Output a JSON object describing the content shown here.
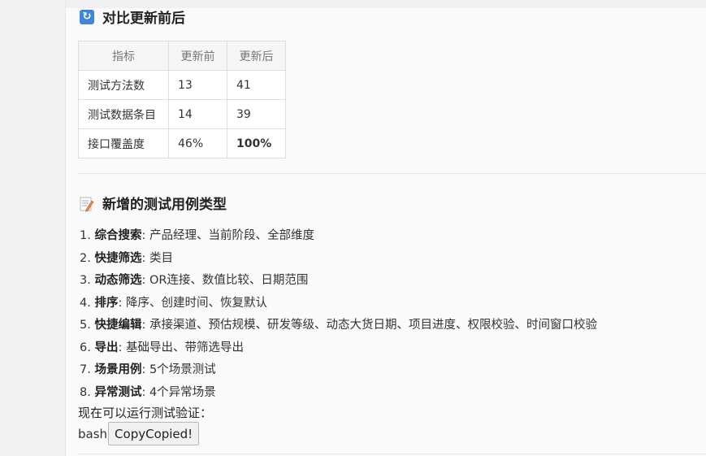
{
  "section1": {
    "title": "对比更新前后",
    "icon": "refresh-icon"
  },
  "table": {
    "headers": [
      "指标",
      "更新前",
      "更新后"
    ],
    "rows": [
      [
        "测试方法数",
        "13",
        "41"
      ],
      [
        "测试数据条目",
        "14",
        "39"
      ],
      [
        "接口覆盖度",
        "46%",
        "100%"
      ]
    ]
  },
  "section2": {
    "title": "新增的测试用例类型",
    "icon": "memo-icon"
  },
  "features": [
    {
      "num": "1.",
      "name": "综合搜索",
      "desc": ": 产品经理、当前阶段、全部维度"
    },
    {
      "num": "2.",
      "name": "快捷筛选",
      "desc": ": 类目"
    },
    {
      "num": "3.",
      "name": "动态筛选",
      "desc": ": OR连接、数值比较、日期范围"
    },
    {
      "num": "4.",
      "name": "排序",
      "desc": ": 降序、创建时间、恢复默认"
    },
    {
      "num": "5.",
      "name": "快捷编辑",
      "desc": ": 承接渠道、预估规模、研发等级、动态大货日期、项目进度、权限校验、时间窗口校验"
    },
    {
      "num": "6.",
      "name": "导出",
      "desc": ": 基础导出、带筛选导出"
    },
    {
      "num": "7.",
      "name": "场景用例",
      "desc": ": 5个场景测试"
    },
    {
      "num": "8.",
      "name": "异常测试",
      "desc": ": 4个异常场景"
    }
  ],
  "note": "现在可以运行测试验证：",
  "code": {
    "lang": "bash",
    "copy_label": "CopyCopied!"
  },
  "colors": {
    "icon_blue": "#3f86d6",
    "border": "#dedede"
  }
}
